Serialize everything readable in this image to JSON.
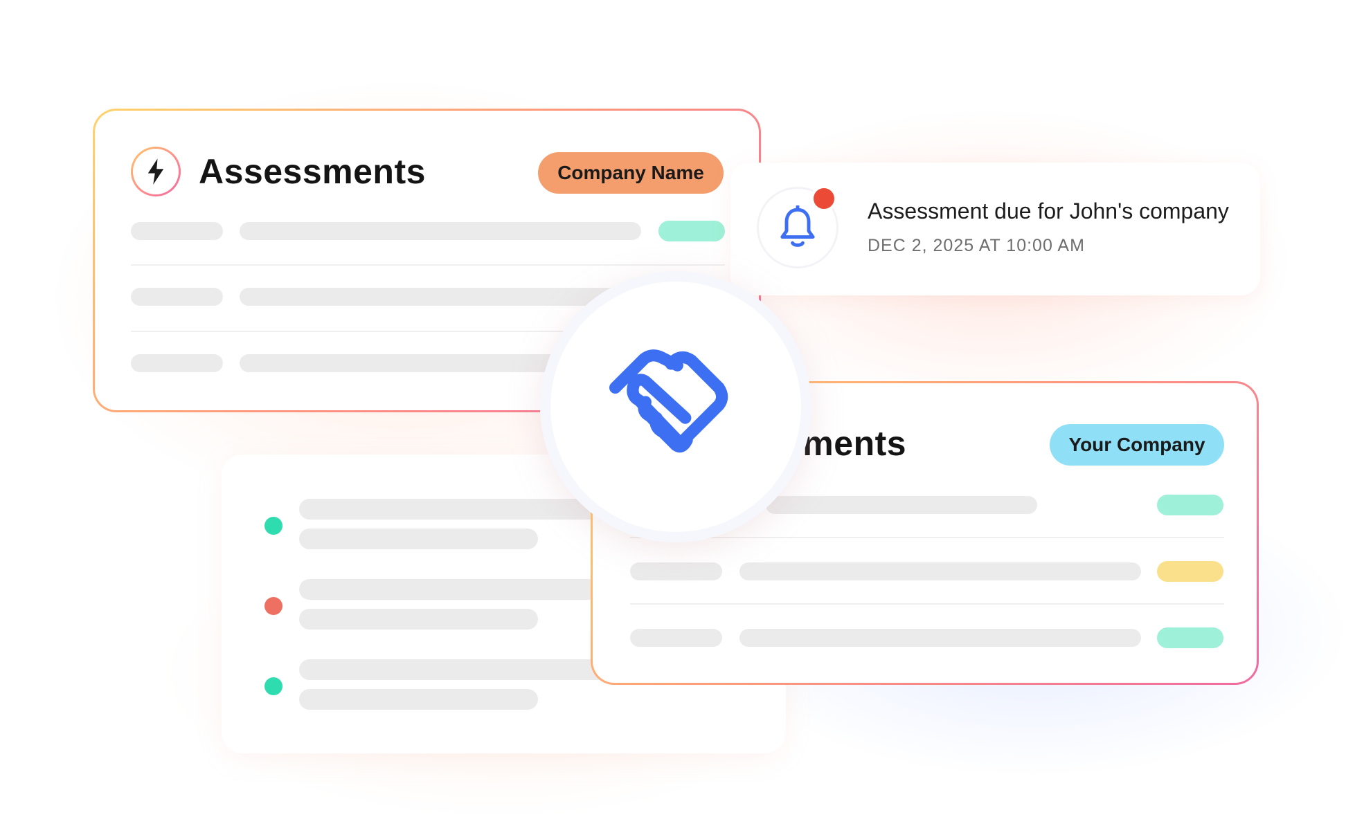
{
  "colors": {
    "accent_blue": "#3d6ff2",
    "orange_pill": "#f49e6d",
    "blue_pill": "#8fdff7",
    "tag_green": "#9ef0d8",
    "tag_yellow": "#fae08a",
    "dot_green": "#2fdcb0",
    "dot_red": "#ee7062",
    "notification_red": "#ea4a36"
  },
  "assessments_card": {
    "title": "Assessments",
    "icon": "lightning-icon",
    "badge": "Company Name"
  },
  "notification": {
    "icon": "bell-icon",
    "message": "Assessment due for John's company",
    "timestamp": "DEC 2, 2025 AT 10:00 AM"
  },
  "center": {
    "icon": "handshake-icon"
  },
  "your_company_card": {
    "title_visible": "sments",
    "badge": "Your Company"
  }
}
